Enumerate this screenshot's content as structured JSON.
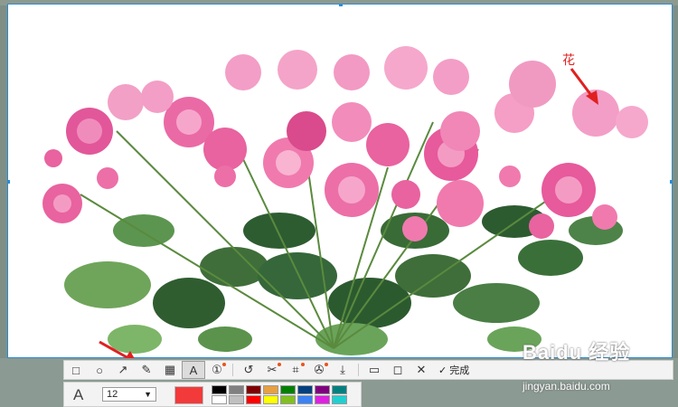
{
  "annotation": {
    "label": "花"
  },
  "toolbar": {
    "tools": [
      {
        "name": "rectangle-tool",
        "glyph": "□"
      },
      {
        "name": "ellipse-tool",
        "glyph": "○"
      },
      {
        "name": "arrow-tool",
        "glyph": "↗"
      },
      {
        "name": "pencil-tool",
        "glyph": "✎"
      },
      {
        "name": "mosaic-tool",
        "glyph": "▦"
      },
      {
        "name": "text-tool",
        "glyph": "A"
      },
      {
        "name": "number-tool",
        "glyph": "①"
      },
      {
        "name": "undo-tool",
        "glyph": "↺"
      },
      {
        "name": "cut-tool",
        "glyph": "✂"
      },
      {
        "name": "crop-tool",
        "glyph": "⌗"
      },
      {
        "name": "pin-tool",
        "glyph": "✇"
      },
      {
        "name": "download-tool",
        "glyph": "⤓"
      },
      {
        "name": "save-tool",
        "glyph": "▭"
      },
      {
        "name": "share-tool",
        "glyph": "◻"
      },
      {
        "name": "cancel-tool",
        "glyph": "✕"
      }
    ],
    "finish_label": "完成"
  },
  "text_props": {
    "font_glyph": "A",
    "font_size": "12",
    "current_color": "#f23a3a"
  },
  "palette": [
    "#000000",
    "#808080",
    "#800000",
    "#e8a040",
    "#008000",
    "#004080",
    "#800080",
    "#008080",
    "#ffffff",
    "#c0c0c0",
    "#ff0000",
    "#ffff00",
    "#80c020",
    "#3b82f6",
    "#e020e0",
    "#20d0d0"
  ],
  "watermark": {
    "text": "Baidu 经验",
    "sub": "jingyan.baidu.com"
  }
}
